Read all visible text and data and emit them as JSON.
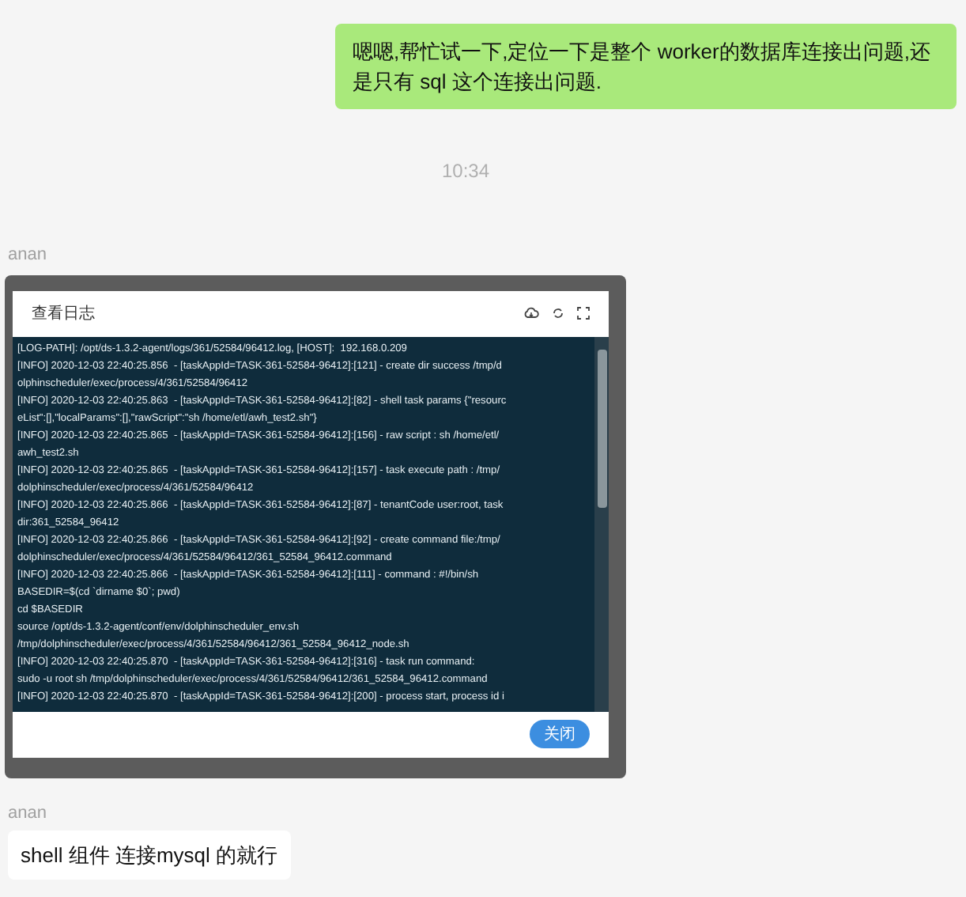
{
  "messages": [
    {
      "kind": "outgoing",
      "text": "嗯嗯,帮忙试一下,定位一下是整个 worker的数据库连接出问题,还是只有 sql 这个连接出问题."
    },
    {
      "kind": "time",
      "text": "10:34"
    },
    {
      "kind": "screenshot",
      "sender": "anan",
      "dialog": {
        "title": "查看日志",
        "close_button": "关闭",
        "log_lines": [
          "[LOG-PATH]: /opt/ds-1.3.2-agent/logs/361/52584/96412.log, [HOST]:  192.168.0.209",
          "[INFO] 2020-12-03 22:40:25.856  - [taskAppId=TASK-361-52584-96412]:[121] - create dir success /tmp/d",
          "olphinscheduler/exec/process/4/361/52584/96412",
          "[INFO] 2020-12-03 22:40:25.863  - [taskAppId=TASK-361-52584-96412]:[82] - shell task params {\"resourc",
          "eList\":[],\"localParams\":[],\"rawScript\":\"sh /home/etl/awh_test2.sh\"}",
          "[INFO] 2020-12-03 22:40:25.865  - [taskAppId=TASK-361-52584-96412]:[156] - raw script : sh /home/etl/",
          "awh_test2.sh",
          "[INFO] 2020-12-03 22:40:25.865  - [taskAppId=TASK-361-52584-96412]:[157] - task execute path : /tmp/",
          "dolphinscheduler/exec/process/4/361/52584/96412",
          "[INFO] 2020-12-03 22:40:25.866  - [taskAppId=TASK-361-52584-96412]:[87] - tenantCode user:root, task",
          "dir:361_52584_96412",
          "[INFO] 2020-12-03 22:40:25.866  - [taskAppId=TASK-361-52584-96412]:[92] - create command file:/tmp/",
          "dolphinscheduler/exec/process/4/361/52584/96412/361_52584_96412.command",
          "[INFO] 2020-12-03 22:40:25.866  - [taskAppId=TASK-361-52584-96412]:[111] - command : #!/bin/sh",
          "BASEDIR=$(cd `dirname $0`; pwd)",
          "cd $BASEDIR",
          "source /opt/ds-1.3.2-agent/conf/env/dolphinscheduler_env.sh",
          "/tmp/dolphinscheduler/exec/process/4/361/52584/96412/361_52584_96412_node.sh",
          "[INFO] 2020-12-03 22:40:25.870  - [taskAppId=TASK-361-52584-96412]:[316] - task run command:",
          "sudo -u root sh /tmp/dolphinscheduler/exec/process/4/361/52584/96412/361_52584_96412.command",
          "[INFO] 2020-12-03 22:40:25.870  - [taskAppId=TASK-361-52584-96412]:[200] - process start, process id i"
        ]
      }
    },
    {
      "kind": "incoming",
      "sender": "anan",
      "text": "shell 组件 连接mysql 的就行"
    }
  ]
}
